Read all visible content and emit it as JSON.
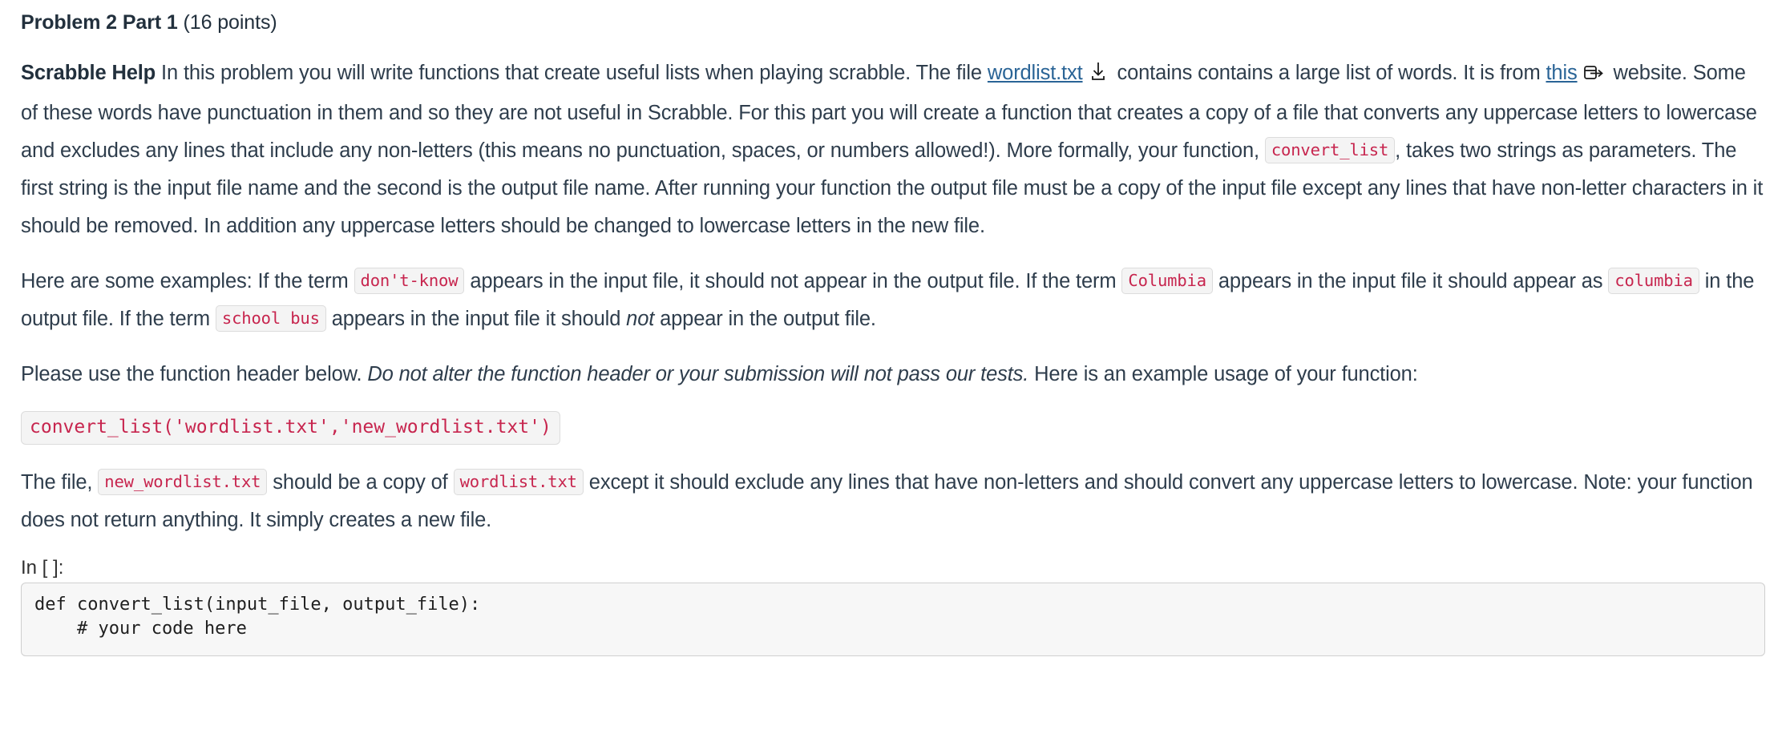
{
  "heading": {
    "title_bold": "Problem 2 Part 1",
    "points": " (16 points)"
  },
  "paragraphs": {
    "p1": {
      "lead_bold": "Scrabble Help",
      "t1": " In this problem you will write functions that create useful lists when playing scrabble. The file ",
      "link_wordlist": "wordlist.txt",
      "download_icon": "download-icon",
      "t2": " contains contains a large list of words. It is from ",
      "link_this": "this",
      "external_icon": "external-link-icon",
      "t3": " website. Some of these words have punctuation in them and so they are not useful in Scrabble. For this part you will create a function that creates a copy of a file that converts any uppercase letters to lowercase and excludes any lines that include any non-letters (this means no punctuation, spaces, or numbers allowed!). More formally, your function, ",
      "code_convert_list": "convert_list",
      "t4": ", takes two strings as parameters. The first string is the input file name and the second is the output file name. After running your function the output file must be a copy of the input file except any lines that have non-letter characters in it should be removed. In addition any uppercase letters should be changed to lowercase letters in the new file."
    },
    "p2": {
      "t1": "Here are some examples: If the term ",
      "code_dont_know": "don't-know",
      "t2": " appears in the input file, it should not appear in the output file. If the term ",
      "code_columbia_upper": "Columbia",
      "t3": " appears in the input file it should appear as ",
      "code_columbia_lower": "columbia",
      "t4": " in the output file. If the term ",
      "code_school_bus": "school bus",
      "t5": " appears in the input file it should ",
      "t5_italic": "not",
      "t6": " appear in the output file."
    },
    "p3": {
      "t1": "Please use the function header below. ",
      "italic": "Do not alter the function header or your submission will not pass our tests.",
      "t2": " Here is an example usage of your function:"
    },
    "code_example": "convert_list('wordlist.txt','new_wordlist.txt')",
    "p4": {
      "t1": "The file, ",
      "code_new_wordlist": "new_wordlist.txt",
      "t2": " should be a copy of ",
      "code_wordlist": "wordlist.txt",
      "t3": " except it should exclude any lines that have non-letters and should convert any uppercase letters to lowercase. Note: your function does not return anything. It simply creates a new file."
    }
  },
  "cell": {
    "prompt": "In [ ]:",
    "code": "def convert_list(input_file, output_file):\n    # your code here"
  },
  "colors": {
    "link": "#2a6496",
    "code_text": "#c7254e",
    "code_bg": "#f4f4f4",
    "body_text": "#2e3d4c",
    "cell_bg": "#f7f7f7"
  }
}
